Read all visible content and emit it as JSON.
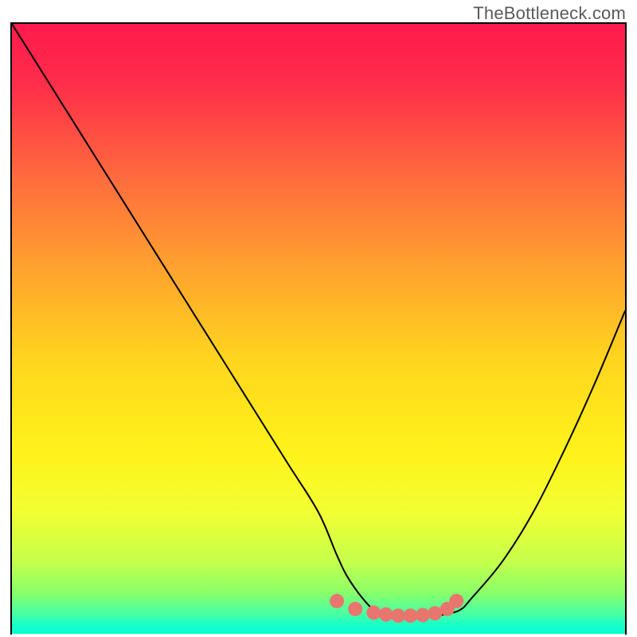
{
  "attribution": "TheBottleneck.com",
  "colors": {
    "frame": "#000000",
    "curve": "#000000",
    "marker_fill": "#e8766e",
    "marker_stroke": "#e8766e",
    "gradient_stops": [
      {
        "offset": 0.0,
        "color": "#ff1a4d"
      },
      {
        "offset": 0.1,
        "color": "#ff2e4a"
      },
      {
        "offset": 0.25,
        "color": "#ff6a3e"
      },
      {
        "offset": 0.4,
        "color": "#ffa22e"
      },
      {
        "offset": 0.55,
        "color": "#ffd51e"
      },
      {
        "offset": 0.7,
        "color": "#fff21a"
      },
      {
        "offset": 0.8,
        "color": "#f2ff33"
      },
      {
        "offset": 0.88,
        "color": "#c6ff4a"
      },
      {
        "offset": 0.93,
        "color": "#8dff66"
      },
      {
        "offset": 0.965,
        "color": "#4dffa0"
      },
      {
        "offset": 0.985,
        "color": "#1affc8"
      },
      {
        "offset": 1.0,
        "color": "#00ffd0"
      }
    ]
  },
  "chart_data": {
    "type": "line",
    "title": "",
    "xlabel": "",
    "ylabel": "",
    "xlim": [
      0,
      100
    ],
    "ylim": [
      0,
      100
    ],
    "series": [
      {
        "name": "bottleneck-curve",
        "x": [
          0,
          5,
          10,
          15,
          20,
          25,
          30,
          35,
          40,
          45,
          50,
          53,
          55,
          58,
          60,
          63,
          65,
          68,
          70,
          73,
          75,
          80,
          85,
          90,
          95,
          100
        ],
        "y": [
          100,
          92,
          84,
          76,
          68,
          60,
          52,
          44,
          36,
          28,
          20,
          13,
          9,
          5,
          3.5,
          3,
          3,
          3,
          3.2,
          4,
          6,
          12,
          20,
          30,
          41,
          53
        ]
      }
    ],
    "markers": {
      "name": "highlighted-range",
      "x": [
        53,
        56,
        59,
        61,
        63,
        65,
        67,
        69,
        71,
        72.5
      ],
      "y": [
        5.5,
        4.2,
        3.6,
        3.3,
        3.1,
        3.1,
        3.2,
        3.5,
        4.2,
        5.5
      ]
    }
  }
}
